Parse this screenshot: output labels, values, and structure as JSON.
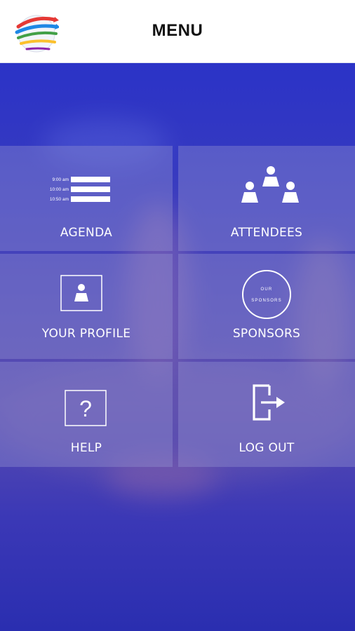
{
  "header": {
    "title": "MENU",
    "logo_icon": "globe-arrows-logo"
  },
  "menu": {
    "agenda": {
      "label": "AGENDA",
      "icon": "agenda-schedule-icon",
      "times": [
        "9:00 am",
        "10:00 am",
        "10:50 am"
      ]
    },
    "attendees": {
      "label": "ATTENDEES",
      "icon": "people-group-icon"
    },
    "profile": {
      "label": "YOUR PROFILE",
      "icon": "profile-card-icon"
    },
    "sponsors": {
      "label": "SPONSORS",
      "icon": "sponsors-badge-icon",
      "badge_top": "OUR",
      "badge_bottom": "SPONSORS"
    },
    "help": {
      "label": "HELP",
      "icon": "help-question-icon",
      "glyph": "?"
    },
    "logout": {
      "label": "LOG OUT",
      "icon": "logout-door-icon"
    }
  },
  "colors": {
    "header_bg": "#ffffff",
    "overlay": "#2b33c7",
    "tile": "rgba(150,150,210,0.38)",
    "text": "#ffffff"
  }
}
